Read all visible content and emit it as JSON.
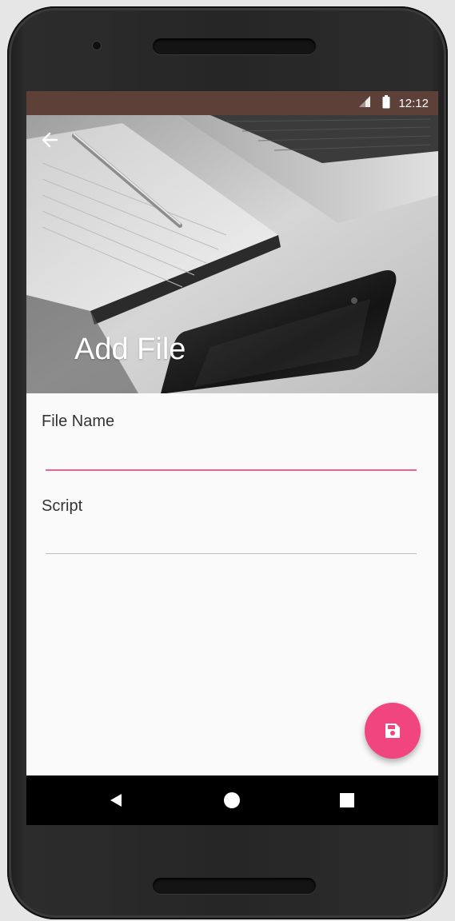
{
  "status_bar": {
    "time": "12:12",
    "signal_icon": "signal-icon",
    "battery_icon": "battery-icon",
    "color": "#5d4037"
  },
  "header": {
    "title": "Add File",
    "back_icon": "arrow-back-icon"
  },
  "form": {
    "file_name": {
      "label": "File Name",
      "value": "",
      "underline_color": "#f06292"
    },
    "script": {
      "label": "Script",
      "value": "",
      "underline_color": "#bdbdbd"
    }
  },
  "fab": {
    "icon": "save-icon",
    "color": "#f0457f"
  },
  "nav": {
    "back_icon": "nav-back-icon",
    "home_icon": "nav-home-icon",
    "recents_icon": "nav-recents-icon"
  }
}
